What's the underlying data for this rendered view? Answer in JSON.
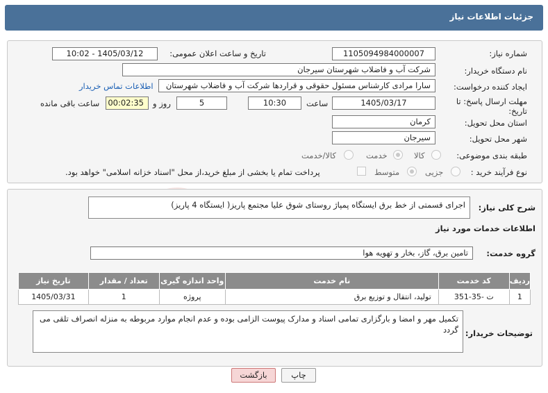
{
  "header": {
    "title": "جزئیات اطلاعات نیاز"
  },
  "form": {
    "need_number_label": "شماره نیاز:",
    "need_number": "1105094984000007",
    "announce_label": "تاریخ و ساعت اعلان عمومی:",
    "announce_value": "1405/03/12 - 10:02",
    "buyer_label": "نام دستگاه خریدار:",
    "buyer_value": "شرکت آب و فاضلاب شهرستان سیرجان",
    "creator_label": "ایجاد کننده درخواست:",
    "creator_value": "سارا مرادی کارشناس مسئول حقوقی و قراردها شرکت آب و فاضلاب شهرستان",
    "contact_link": "اطلاعات تماس خریدار",
    "deadline_label": "مهلت ارسال پاسخ: تا تاریخ:",
    "deadline_date": "1405/03/17",
    "time_label": "ساعت",
    "deadline_time": "10:30",
    "days_value": "5",
    "days_label": "روز و",
    "remaining_value": "00:02:35",
    "remaining_label": "ساعت باقی مانده",
    "province_label": "استان محل تحویل:",
    "province_value": "کرمان",
    "city_label": "شهر محل تحویل:",
    "city_value": "سیرجان",
    "category_label": "طبقه بندی موضوعی:",
    "category_options": [
      "کالا",
      "خدمت",
      "کالا/خدمت"
    ],
    "category_selected": "خدمت",
    "process_label": "نوع فرآیند خرید :",
    "process_options": [
      "جزیی",
      "متوسط"
    ],
    "process_selected": "متوسط",
    "payment_note": "پرداخت تمام یا بخشی از مبلغ خرید،از محل \"اسناد خزانه اسلامی\" خواهد بود."
  },
  "summary": {
    "label": "شرح کلی نیاز:",
    "value": "اجرای قسمتی از خط برق ایستگاه پمپاژ روستای شوق علیا مجتمع پاریز( ایستگاه 4 پاریز)"
  },
  "services": {
    "title": "اطلاعات خدمات مورد نیاز",
    "group_label": "گروه خدمت:",
    "group_value": "تامین برق، گاز، بخار و تهویه هوا",
    "columns": [
      "ردیف",
      "کد خدمت",
      "نام خدمت",
      "واحد اندازه گیری",
      "تعداد / مقدار",
      "تاریخ نیاز"
    ],
    "rows": [
      [
        "1",
        "ت -35-351",
        "تولید، انتقال و توزیع برق",
        "پروژه",
        "1",
        "1405/03/31"
      ]
    ]
  },
  "buyer_notes": {
    "label": "توضیحات خریدار:",
    "value": "تکمیل مهر و امضا و بارگزاری تمامی اسناد و مدارک پیوست الزامی بوده و عدم انجام موارد مربوطه به منزله انصراف تلقی می گردد"
  },
  "buttons": {
    "print": "چاپ",
    "back": "بازگشت"
  },
  "colors": {
    "header": "#4a7199",
    "link": "#1a5fb4",
    "table_header": "#8c8c8c",
    "remaining_bg": "#ffffcc"
  }
}
